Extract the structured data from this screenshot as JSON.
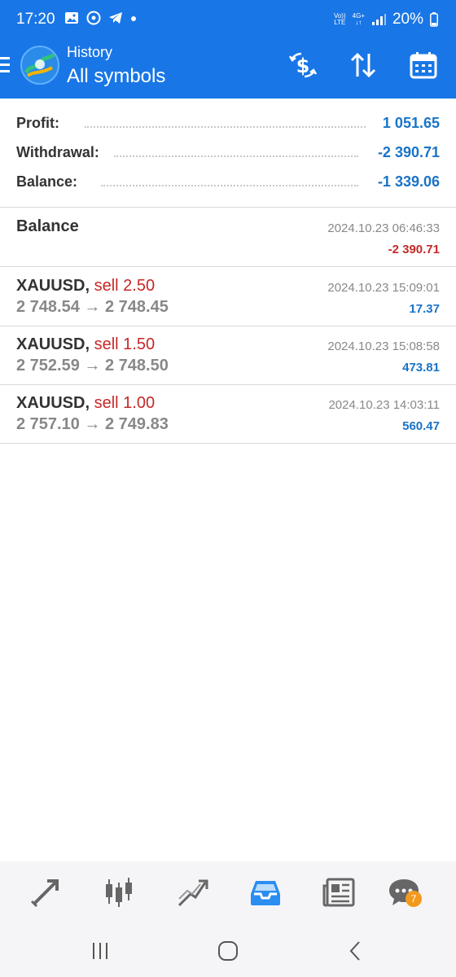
{
  "status_bar": {
    "time": "17:20",
    "network_top": "Vo))",
    "network_bottom": "LTE",
    "data_top": "4G+",
    "data_bottom": "↓↑",
    "battery": "20%"
  },
  "header": {
    "small_title": "History",
    "title": "All symbols",
    "accent_color": "#1976e6"
  },
  "summary": {
    "rows": [
      {
        "label": "Profit:",
        "value": "1 051.65"
      },
      {
        "label": "Withdrawal:",
        "value": "-2 390.71"
      },
      {
        "label": "Balance:",
        "value": "-1 339.06"
      }
    ]
  },
  "entries": [
    {
      "name": "Balance",
      "type": "",
      "prices": "",
      "date": "2024.10.23 06:46:33",
      "amount": "-2 390.71",
      "negative": true
    },
    {
      "name": "XAUUSD,",
      "type": "sell 2.50",
      "prices": "2 748.54 → 2 748.45",
      "date": "2024.10.23 15:09:01",
      "amount": "17.37",
      "negative": false
    },
    {
      "name": "XAUUSD,",
      "type": "sell 1.50",
      "prices": "2 752.59 → 2 748.50",
      "date": "2024.10.23 15:08:58",
      "amount": "473.81",
      "negative": false
    },
    {
      "name": "XAUUSD,",
      "type": "sell 1.00",
      "prices": "2 757.10 → 2 749.83",
      "date": "2024.10.23 14:03:11",
      "amount": "560.47",
      "negative": false
    }
  ],
  "bottom_tabs": [
    {
      "icon": "quotes-icon",
      "active": false
    },
    {
      "icon": "chart-candles-icon",
      "active": false
    },
    {
      "icon": "trade-icon",
      "active": false
    },
    {
      "icon": "history-inbox-icon",
      "active": true
    },
    {
      "icon": "news-icon",
      "active": false
    },
    {
      "icon": "messages-icon",
      "active": false,
      "badge": "7"
    }
  ],
  "colors": {
    "profit_blue": "#1a73c7",
    "loss_red": "#c62828",
    "icon_gray": "#666666"
  }
}
